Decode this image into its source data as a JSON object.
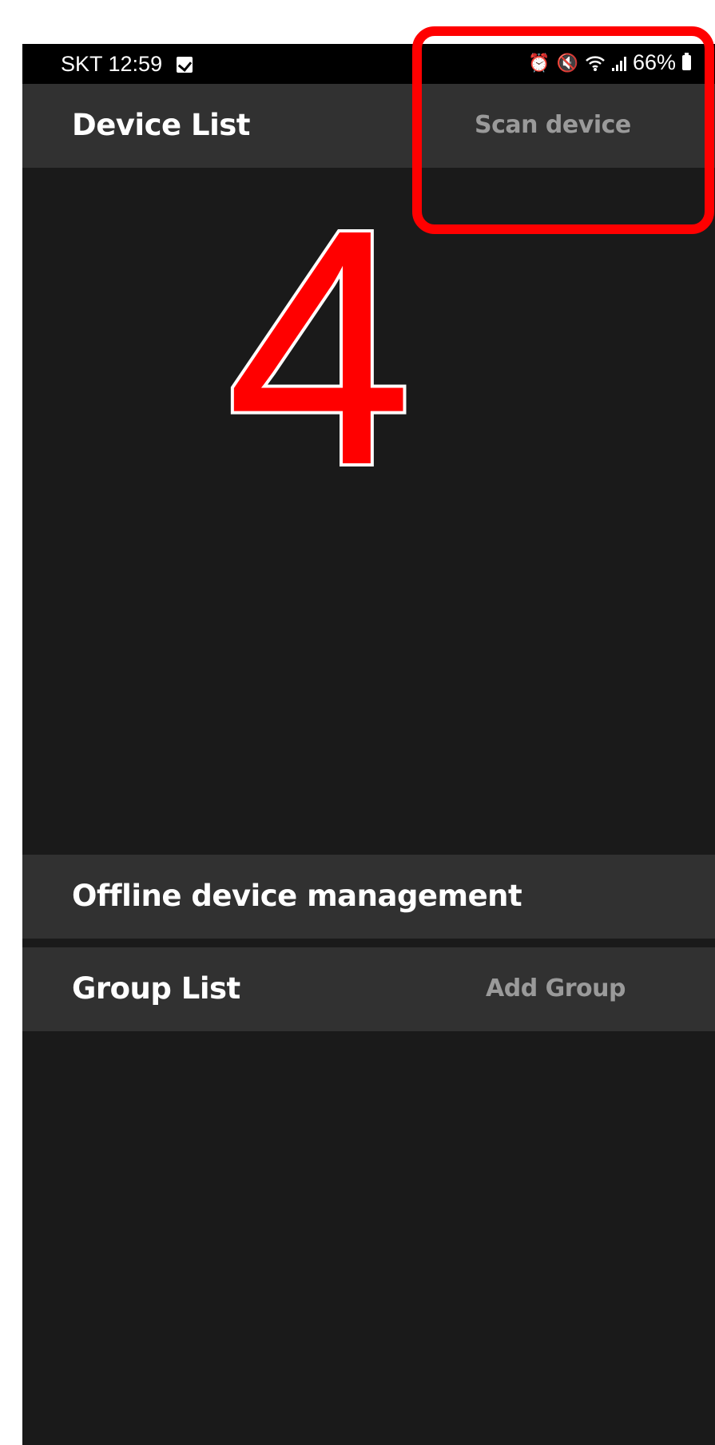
{
  "status_bar": {
    "carrier_time": "SKT 12:59",
    "battery": "66%",
    "icons": [
      "checkbox-notification-icon",
      "alarm-icon",
      "mute-icon",
      "wifi-icon",
      "signal-icon",
      "battery-icon"
    ]
  },
  "device_list": {
    "title": "Device List",
    "action": "Scan device"
  },
  "offline": {
    "title": "Offline device management"
  },
  "group_list": {
    "title": "Group List",
    "action": "Add Group"
  },
  "annotation": {
    "step": "4",
    "color": "#ff0000"
  },
  "colors": {
    "background": "#1a1a1a",
    "header_bg": "#313131",
    "status_bg": "#000000",
    "title": "#ffffff",
    "action": "#9a9a9a"
  }
}
